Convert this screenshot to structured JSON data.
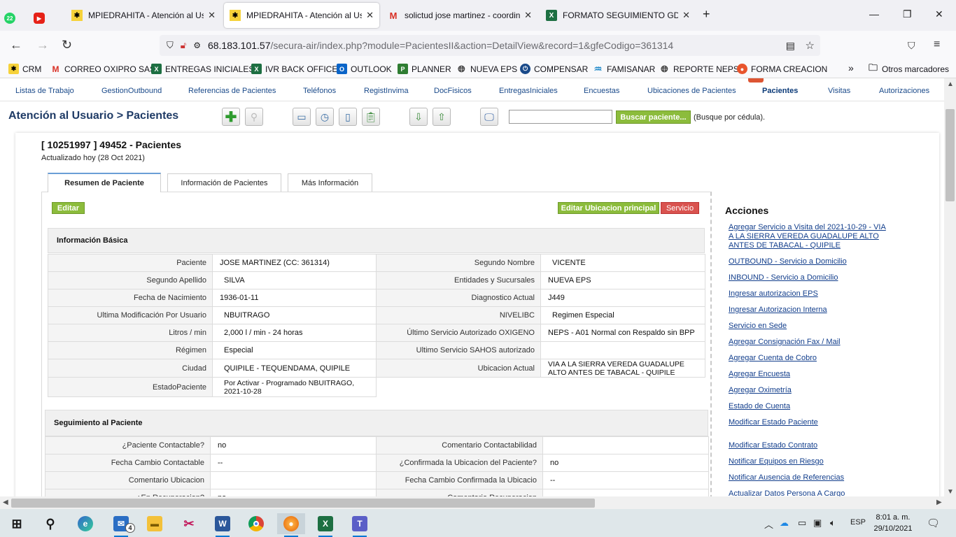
{
  "browser": {
    "tabs": [
      {
        "label": "MPIEDRAHITA - Atención al Usu",
        "icon": "sugar-icon",
        "active": false
      },
      {
        "label": "MPIEDRAHITA - Atención al Usu",
        "icon": "sugar-icon",
        "active": true
      },
      {
        "label": "solictud jose martinez - coordin",
        "icon": "gmail-icon",
        "active": false
      },
      {
        "label": "FORMATO SEGUIMIENTO GD.xls",
        "icon": "excel-icon",
        "active": false
      }
    ],
    "pinned_badge": "22",
    "url_host": "68.183.101.57",
    "url_path": "/secura-air/index.php?module=PacientesII&action=DetailView&record=1&gfeCodigo=361314",
    "bookmarks": [
      "CRM",
      "CORREO OXIPRO SAS",
      "ENTREGAS INICIALES",
      "IVR BACK OFFICE",
      "OUTLOOK",
      "PLANNER",
      "NUEVA EPS",
      "COMPENSAR",
      "FAMISANAR",
      "REPORTE NEPS",
      "FORMA CREACION"
    ],
    "other_bookmarks": "Otros marcadores"
  },
  "module_menu": [
    "Listas de Trabajo",
    "GestionOutbound",
    "Referencias de Pacientes",
    "Teléfonos",
    "RegistInvima",
    "DocFisicos",
    "EntregasIniciales",
    "Encuestas",
    "Ubicaciones de Pacientes",
    "Pacientes",
    "Visitas",
    "Autorizaciones"
  ],
  "page": {
    "title": "Atención al Usuario > Pacientes",
    "search_button": "Buscar paciente...",
    "search_hint": "(Busque por cédula).",
    "record_title": "[ 10251997 ] 49452 - Pacientes",
    "updated": "Actualizado hoy (28 Oct 2021)"
  },
  "tabs": [
    "Resumen de Paciente",
    "Información de Pacientes",
    "Más Información"
  ],
  "buttons": {
    "edit": "Editar",
    "edit_location": "Editar Ubicacion principal",
    "service": "Servicio"
  },
  "basic_info": {
    "heading": "Información Básica",
    "rows": [
      [
        {
          "l": "Paciente",
          "v": "JOSE MARTINEZ (CC: 361314)"
        },
        {
          "l": "Segundo Nombre",
          "v": "VICENTE"
        }
      ],
      [
        {
          "l": "Segundo Apellido",
          "v": "SILVA"
        },
        {
          "l": "Entidades y Sucursales",
          "v": "NUEVA EPS"
        }
      ],
      [
        {
          "l": "Fecha de Nacimiento",
          "v": "1936-01-11"
        },
        {
          "l": "Diagnostico Actual",
          "v": "J449"
        }
      ],
      [
        {
          "l": "Ultima Modificación Por Usuario",
          "v": "NBUITRAGO"
        },
        {
          "l": "NIVELIBC",
          "v": "Regimen Especial"
        }
      ],
      [
        {
          "l": "Litros / min",
          "v": "2,000 l / min - 24 horas"
        },
        {
          "l": "Último Servicio Autorizado OXIGENO",
          "v": "NEPS - A01 Normal con Respaldo sin BPP"
        }
      ],
      [
        {
          "l": "Régimen",
          "v": "Especial"
        },
        {
          "l": "Ultimo Servicio SAHOS autorizado",
          "v": ""
        }
      ],
      [
        {
          "l": "Ciudad",
          "v": "QUIPILE - TEQUENDAMA, QUIPILE"
        },
        {
          "l": "Ubicacion Actual",
          "v": "VIA A LA SIERRA VEREDA GUADALUPE ALTO ANTES DE TABACAL - QUIPILE"
        }
      ],
      [
        {
          "l": "EstadoPaciente",
          "v": "Por Activar - Programado NBUITRAGO, 2021-10-28"
        }
      ]
    ]
  },
  "followup": {
    "heading": "Seguimiento al Paciente",
    "rows": [
      [
        {
          "l": "¿Paciente Contactable?",
          "v": "no"
        },
        {
          "l": "Comentario Contactabilidad",
          "v": ""
        }
      ],
      [
        {
          "l": "Fecha Cambio Contactable",
          "v": "--"
        },
        {
          "l": "¿Confirmada la Ubicacion del Paciente?",
          "v": "no"
        }
      ],
      [
        {
          "l": "Comentario Ubicacion",
          "v": ""
        },
        {
          "l": "Fecha Cambio Confirmada la Ubicacio",
          "v": "--"
        }
      ],
      [
        {
          "l": "¿En Recuperacion?",
          "v": "no"
        },
        {
          "l": "Comentario Recuperacion",
          "v": ""
        }
      ]
    ]
  },
  "acciones": {
    "heading": "Acciones",
    "links": [
      "Agregar Servicio a Visita del 2021-10-29 - VIA A LA SIERRA VEREDA GUADALUPE ALTO ANTES DE TABACAL - QUIPILE",
      "OUTBOUND - Servicio a Domicilio",
      "INBOUND - Servicio a Domicilio",
      "Ingresar autorizacion EPS",
      "Ingresar Autorizacion Interna",
      "Servicio en Sede",
      "Agregar Consignación Fax / Mail",
      "Agregar Cuenta de Cobro",
      "Agregar Encuesta",
      "Agregar Oximetría",
      "Estado de Cuenta",
      "Modificar Estado Paciente",
      "Modificar Estado Contrato",
      "Notificar Equipos en Riesgo",
      "Notificar Ausencia de Referencias",
      "Actualizar Datos Persona A Cargo"
    ]
  },
  "taskbar": {
    "mail_badge": "4",
    "lang": "ESP",
    "time": "8:01 a. m.",
    "date": "29/10/2021"
  }
}
